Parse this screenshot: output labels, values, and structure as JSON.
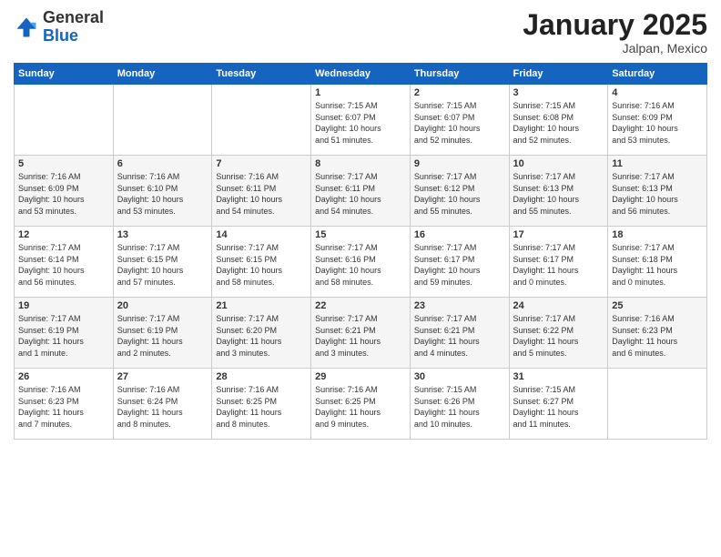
{
  "header": {
    "logo_general": "General",
    "logo_blue": "Blue",
    "title": "January 2025",
    "subtitle": "Jalpan, Mexico"
  },
  "weekdays": [
    "Sunday",
    "Monday",
    "Tuesday",
    "Wednesday",
    "Thursday",
    "Friday",
    "Saturday"
  ],
  "weeks": [
    [
      {
        "day": "",
        "info": ""
      },
      {
        "day": "",
        "info": ""
      },
      {
        "day": "",
        "info": ""
      },
      {
        "day": "1",
        "info": "Sunrise: 7:15 AM\nSunset: 6:07 PM\nDaylight: 10 hours\nand 51 minutes."
      },
      {
        "day": "2",
        "info": "Sunrise: 7:15 AM\nSunset: 6:07 PM\nDaylight: 10 hours\nand 52 minutes."
      },
      {
        "day": "3",
        "info": "Sunrise: 7:15 AM\nSunset: 6:08 PM\nDaylight: 10 hours\nand 52 minutes."
      },
      {
        "day": "4",
        "info": "Sunrise: 7:16 AM\nSunset: 6:09 PM\nDaylight: 10 hours\nand 53 minutes."
      }
    ],
    [
      {
        "day": "5",
        "info": "Sunrise: 7:16 AM\nSunset: 6:09 PM\nDaylight: 10 hours\nand 53 minutes."
      },
      {
        "day": "6",
        "info": "Sunrise: 7:16 AM\nSunset: 6:10 PM\nDaylight: 10 hours\nand 53 minutes."
      },
      {
        "day": "7",
        "info": "Sunrise: 7:16 AM\nSunset: 6:11 PM\nDaylight: 10 hours\nand 54 minutes."
      },
      {
        "day": "8",
        "info": "Sunrise: 7:17 AM\nSunset: 6:11 PM\nDaylight: 10 hours\nand 54 minutes."
      },
      {
        "day": "9",
        "info": "Sunrise: 7:17 AM\nSunset: 6:12 PM\nDaylight: 10 hours\nand 55 minutes."
      },
      {
        "day": "10",
        "info": "Sunrise: 7:17 AM\nSunset: 6:13 PM\nDaylight: 10 hours\nand 55 minutes."
      },
      {
        "day": "11",
        "info": "Sunrise: 7:17 AM\nSunset: 6:13 PM\nDaylight: 10 hours\nand 56 minutes."
      }
    ],
    [
      {
        "day": "12",
        "info": "Sunrise: 7:17 AM\nSunset: 6:14 PM\nDaylight: 10 hours\nand 56 minutes."
      },
      {
        "day": "13",
        "info": "Sunrise: 7:17 AM\nSunset: 6:15 PM\nDaylight: 10 hours\nand 57 minutes."
      },
      {
        "day": "14",
        "info": "Sunrise: 7:17 AM\nSunset: 6:15 PM\nDaylight: 10 hours\nand 58 minutes."
      },
      {
        "day": "15",
        "info": "Sunrise: 7:17 AM\nSunset: 6:16 PM\nDaylight: 10 hours\nand 58 minutes."
      },
      {
        "day": "16",
        "info": "Sunrise: 7:17 AM\nSunset: 6:17 PM\nDaylight: 10 hours\nand 59 minutes."
      },
      {
        "day": "17",
        "info": "Sunrise: 7:17 AM\nSunset: 6:17 PM\nDaylight: 11 hours\nand 0 minutes."
      },
      {
        "day": "18",
        "info": "Sunrise: 7:17 AM\nSunset: 6:18 PM\nDaylight: 11 hours\nand 0 minutes."
      }
    ],
    [
      {
        "day": "19",
        "info": "Sunrise: 7:17 AM\nSunset: 6:19 PM\nDaylight: 11 hours\nand 1 minute."
      },
      {
        "day": "20",
        "info": "Sunrise: 7:17 AM\nSunset: 6:19 PM\nDaylight: 11 hours\nand 2 minutes."
      },
      {
        "day": "21",
        "info": "Sunrise: 7:17 AM\nSunset: 6:20 PM\nDaylight: 11 hours\nand 3 minutes."
      },
      {
        "day": "22",
        "info": "Sunrise: 7:17 AM\nSunset: 6:21 PM\nDaylight: 11 hours\nand 3 minutes."
      },
      {
        "day": "23",
        "info": "Sunrise: 7:17 AM\nSunset: 6:21 PM\nDaylight: 11 hours\nand 4 minutes."
      },
      {
        "day": "24",
        "info": "Sunrise: 7:17 AM\nSunset: 6:22 PM\nDaylight: 11 hours\nand 5 minutes."
      },
      {
        "day": "25",
        "info": "Sunrise: 7:16 AM\nSunset: 6:23 PM\nDaylight: 11 hours\nand 6 minutes."
      }
    ],
    [
      {
        "day": "26",
        "info": "Sunrise: 7:16 AM\nSunset: 6:23 PM\nDaylight: 11 hours\nand 7 minutes."
      },
      {
        "day": "27",
        "info": "Sunrise: 7:16 AM\nSunset: 6:24 PM\nDaylight: 11 hours\nand 8 minutes."
      },
      {
        "day": "28",
        "info": "Sunrise: 7:16 AM\nSunset: 6:25 PM\nDaylight: 11 hours\nand 8 minutes."
      },
      {
        "day": "29",
        "info": "Sunrise: 7:16 AM\nSunset: 6:25 PM\nDaylight: 11 hours\nand 9 minutes."
      },
      {
        "day": "30",
        "info": "Sunrise: 7:15 AM\nSunset: 6:26 PM\nDaylight: 11 hours\nand 10 minutes."
      },
      {
        "day": "31",
        "info": "Sunrise: 7:15 AM\nSunset: 6:27 PM\nDaylight: 11 hours\nand 11 minutes."
      },
      {
        "day": "",
        "info": ""
      }
    ]
  ]
}
